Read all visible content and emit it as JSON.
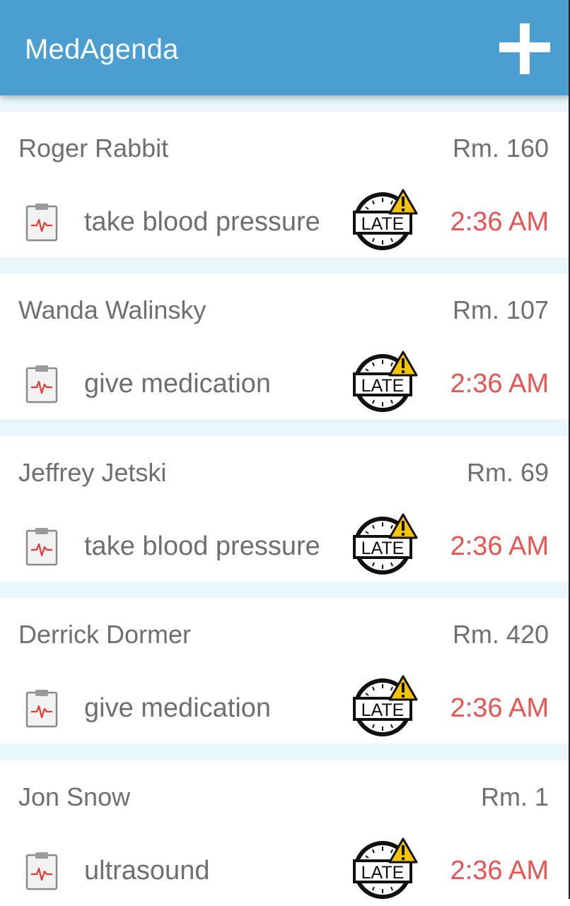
{
  "app": {
    "title": "MedAgenda",
    "add_icon": "plus-icon"
  },
  "colors": {
    "appbar": "#4b9fd0",
    "late_time": "#e65454",
    "background": "#e9f6fc",
    "text": "#6f6f6f",
    "warning": "#f5c400"
  },
  "tasks": [
    {
      "patient": "Roger Rabbit",
      "room": "Rm. 160",
      "task": "take blood pressure",
      "time": "2:36 AM",
      "status": "LATE",
      "icon": "clipboard-icon"
    },
    {
      "patient": "Wanda Walinsky",
      "room": "Rm. 107",
      "task": "give medication",
      "time": "2:36 AM",
      "status": "LATE",
      "icon": "clipboard-icon"
    },
    {
      "patient": "Jeffrey Jetski",
      "room": "Rm. 69",
      "task": "take blood pressure",
      "time": "2:36 AM",
      "status": "LATE",
      "icon": "clipboard-icon"
    },
    {
      "patient": "Derrick Dormer",
      "room": "Rm. 420",
      "task": "give medication",
      "time": "2:36 AM",
      "status": "LATE",
      "icon": "clipboard-icon"
    },
    {
      "patient": "Jon Snow",
      "room": "Rm. 1",
      "task": "ultrasound",
      "time": "2:36 AM",
      "status": "LATE",
      "icon": "clipboard-icon"
    }
  ]
}
